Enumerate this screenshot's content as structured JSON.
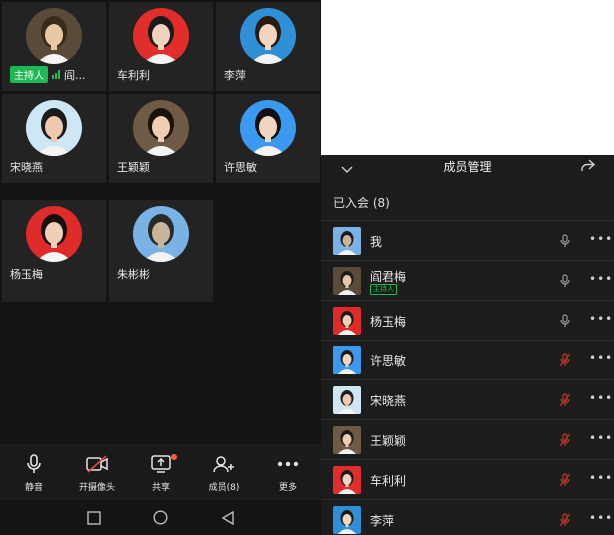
{
  "grid": {
    "tiles": [
      {
        "name": "阎...",
        "host": true,
        "host_label": "主持人",
        "bg": "#5a4a3a",
        "skin": "#e8c7a6",
        "hair": "#3a2a1a"
      },
      {
        "name": "车利利",
        "host": false,
        "bg": "#e22d2d",
        "skin": "#f1d3be",
        "hair": "#1a1a1a"
      },
      {
        "name": "李萍",
        "host": false,
        "bg": "#2f8fd6",
        "skin": "#f2d6bf",
        "hair": "#2a1a10"
      },
      {
        "name": "宋晓燕",
        "host": false,
        "bg": "#cfe6f5",
        "skin": "#eec9ad",
        "hair": "#1a1a1a"
      },
      {
        "name": "王颖颖",
        "host": false,
        "bg": "#6f5a45",
        "skin": "#f0cdb2",
        "hair": "#1a1208"
      },
      {
        "name": "许思敏",
        "host": false,
        "bg": "#3b9af0",
        "skin": "#f3d6c0",
        "hair": "#101010"
      },
      {
        "name": "杨玉梅",
        "host": false,
        "bg": "#e02b2b",
        "skin": "#efcfb8",
        "hair": "#1a0f0f"
      },
      {
        "name": "朱彬彬",
        "host": false,
        "bg": "#7ab2e6",
        "skin": "#c9b59a",
        "hair": "#2a2a2a"
      }
    ]
  },
  "toolbar": {
    "mute": "静音",
    "camera": "开摄像头",
    "share": "共享",
    "members": "成员(8)",
    "more": "更多"
  },
  "panel": {
    "title": "成员管理",
    "joined": "已入会 (8)",
    "members": [
      {
        "name": "我",
        "host": false,
        "mic": "on",
        "bg": "#7ab2e6",
        "skin": "#c9b59a"
      },
      {
        "name": "阎君梅",
        "host": true,
        "host_label": "主持人",
        "mic": "on",
        "bg": "#5a4a3a",
        "skin": "#e8c7a6"
      },
      {
        "name": "杨玉梅",
        "host": false,
        "mic": "on",
        "bg": "#e02b2b",
        "skin": "#efcfb8"
      },
      {
        "name": "许思敏",
        "host": false,
        "mic": "off",
        "bg": "#3b9af0",
        "skin": "#f3d6c0"
      },
      {
        "name": "宋晓燕",
        "host": false,
        "mic": "off",
        "bg": "#cfe6f5",
        "skin": "#eec9ad"
      },
      {
        "name": "王颖颖",
        "host": false,
        "mic": "off",
        "bg": "#6f5a45",
        "skin": "#f0cdb2"
      },
      {
        "name": "车利利",
        "host": false,
        "mic": "off",
        "bg": "#e22d2d",
        "skin": "#f1d3be"
      },
      {
        "name": "李萍",
        "host": false,
        "mic": "off",
        "bg": "#2f8fd6",
        "skin": "#f2d6bf"
      }
    ]
  },
  "colors": {
    "accent_green": "#1db954",
    "muted_red": "#c0392b",
    "notification_dot": "#ff5a3c"
  }
}
